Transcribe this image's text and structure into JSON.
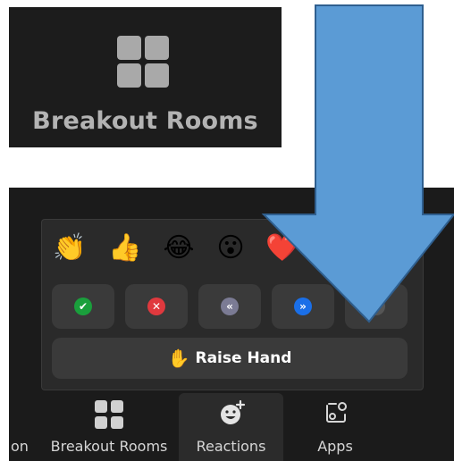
{
  "callout": {
    "label": "Breakout Rooms",
    "icon": "grid-four-squares-icon"
  },
  "reactions_popup": {
    "emojis": [
      {
        "glyph": "👏",
        "name": "clapping-hands"
      },
      {
        "glyph": "👍",
        "name": "thumbs-up"
      },
      {
        "glyph": "😂",
        "name": "tears-of-joy"
      },
      {
        "glyph": "😮",
        "name": "open-mouth"
      },
      {
        "glyph": "❤️",
        "name": "heart"
      }
    ],
    "feedback": [
      {
        "glyph": "✔",
        "name": "yes",
        "color": "#1a9f3c"
      },
      {
        "glyph": "✕",
        "name": "no",
        "color": "#e0393e"
      },
      {
        "glyph": "«",
        "name": "slow-down",
        "color": "#7b7b94"
      },
      {
        "glyph": "»",
        "name": "speed-up",
        "color": "#1a6fe8"
      },
      {
        "glyph": "⋯",
        "name": "more",
        "color": "#555555"
      }
    ],
    "raise_hand": {
      "icon": "✋",
      "label": "Raise Hand"
    }
  },
  "toolbar": {
    "partial_label": "on",
    "items": [
      {
        "label": "Breakout Rooms",
        "icon": "grid-icon"
      },
      {
        "label": "Reactions",
        "icon": "smiley-plus-icon"
      },
      {
        "label": "Apps",
        "icon": "apps-icon"
      }
    ]
  },
  "colors": {
    "arrow_fill": "#5b9bd5",
    "arrow_stroke": "#2f5f8f",
    "panel_bg": "#1c1c1c"
  }
}
